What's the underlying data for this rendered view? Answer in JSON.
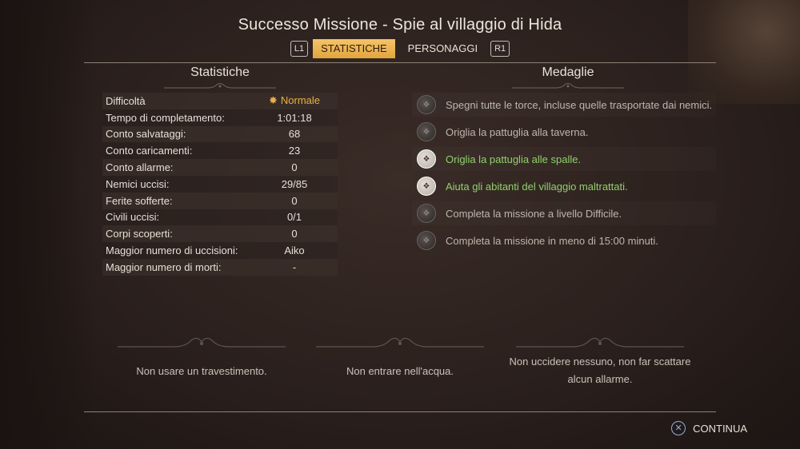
{
  "header": {
    "title": "Successo Missione - Spie al villaggio di Hida",
    "left_shoulder": "L1",
    "right_shoulder": "R1",
    "tabs": [
      "STATISTICHE",
      "PERSONAGGI"
    ]
  },
  "stats": {
    "heading": "Statistiche",
    "rows": [
      {
        "label": "Difficoltà",
        "value": "Normale"
      },
      {
        "label": "Tempo di completamento:",
        "value": "1:01:18"
      },
      {
        "label": "Conto salvataggi:",
        "value": "68"
      },
      {
        "label": "Conto caricamenti:",
        "value": "23"
      },
      {
        "label": "Conto allarme:",
        "value": "0"
      },
      {
        "label": "Nemici uccisi:",
        "value": "29/85"
      },
      {
        "label": "Ferite sofferte:",
        "value": "0"
      },
      {
        "label": "Civili uccisi:",
        "value": "0/1"
      },
      {
        "label": "Corpi scoperti:",
        "value": "0"
      },
      {
        "label": "Maggior numero di uccisioni:",
        "value": "Aiko"
      },
      {
        "label": "Maggior numero di morti:",
        "value": "-"
      }
    ]
  },
  "medals": {
    "heading": "Medaglie",
    "items": [
      {
        "text": "Spegni tutte le torce, incluse quelle trasportate dai nemici.",
        "achieved": false
      },
      {
        "text": "Origlia la pattuglia alla taverna.",
        "achieved": false
      },
      {
        "text": "Origlia la pattuglia alle spalle.",
        "achieved": true
      },
      {
        "text": "Aiuta gli abitanti del villaggio maltrattati.",
        "achieved": true
      },
      {
        "text": "Completa la missione a livello Difficile.",
        "achieved": false
      },
      {
        "text": "Completa la missione in meno di 15:00 minuti.",
        "achieved": false
      }
    ]
  },
  "bonus": [
    {
      "text": "Non usare un travestimento."
    },
    {
      "text": "Non entrare nell'acqua."
    },
    {
      "text": "Non uccidere nessuno, non far scattare alcun allarme."
    }
  ],
  "footer": {
    "continue_label": "CONTINUA",
    "button_icon": "cross-button-icon"
  },
  "colors": {
    "accent": "#e7b04a",
    "achieved": "#8fd16b",
    "tab_active": "#f0b85a"
  }
}
